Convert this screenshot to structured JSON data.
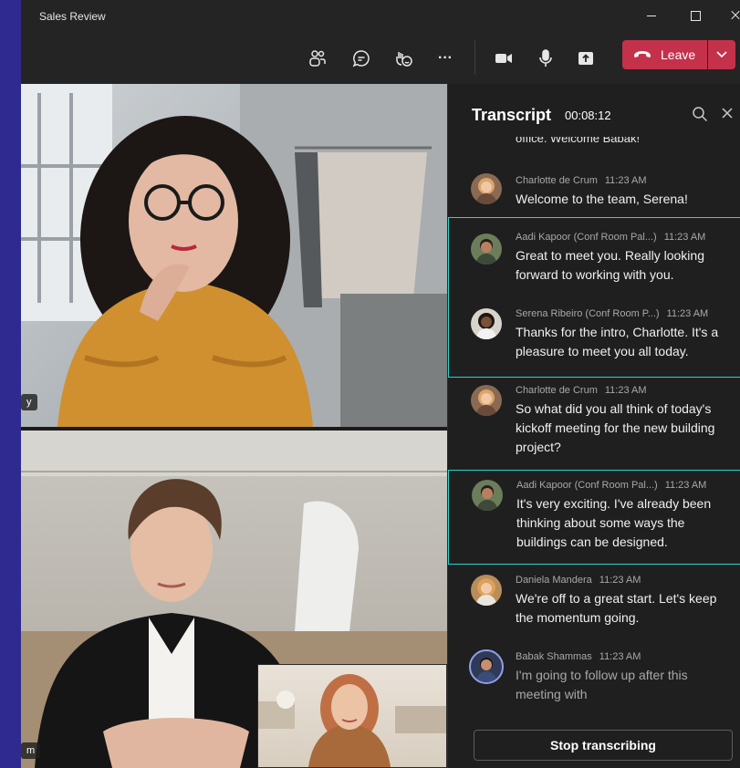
{
  "window": {
    "title": "Sales Review"
  },
  "toolbar": {
    "icons": [
      "people-icon",
      "chat-icon",
      "reactions-icon",
      "more-icon",
      "camera-icon",
      "mic-icon",
      "share-icon"
    ],
    "more_glyph": "···",
    "leave_label": "Leave",
    "colors": {
      "leave": "#c4314b"
    }
  },
  "stage": {
    "tile1_chip": "y",
    "tile2_chip": "m"
  },
  "transcript": {
    "title": "Transcript",
    "elapsed": "00:08:12",
    "cut_text": "office. Welcome Babak!",
    "highlight_color": "#2ad4c6",
    "entries": [
      {
        "name": "Charlotte de Crum",
        "time": "11:23 AM",
        "text": "Welcome to the team, Serena!"
      },
      {
        "name": "Aadi Kapoor (Conf Room Pal...)",
        "time": "11:23 AM",
        "text": "Great to meet you. Really looking forward to working with you."
      },
      {
        "name": "Serena Ribeiro (Conf Room P...)",
        "time": "11:23 AM",
        "text": "Thanks for the intro, Charlotte. It's a pleasure to meet you all today."
      },
      {
        "name": "Charlotte de Crum",
        "time": "11:23 AM",
        "text": "So what did you all think of today's kickoff meeting for the new building project?"
      },
      {
        "name": "Aadi Kapoor (Conf Room Pal...)",
        "time": "11:23 AM",
        "text": "It's very exciting. I've already been thinking about some ways the buildings can be designed."
      },
      {
        "name": "Daniela Mandera",
        "time": "11:23 AM",
        "text": "We're off to a great start. Let's keep the momentum going."
      },
      {
        "name": "Babak Shammas",
        "time": "11:23 AM",
        "text": "I'm going to follow up after this meeting with"
      }
    ],
    "stop_label": "Stop transcribing"
  }
}
